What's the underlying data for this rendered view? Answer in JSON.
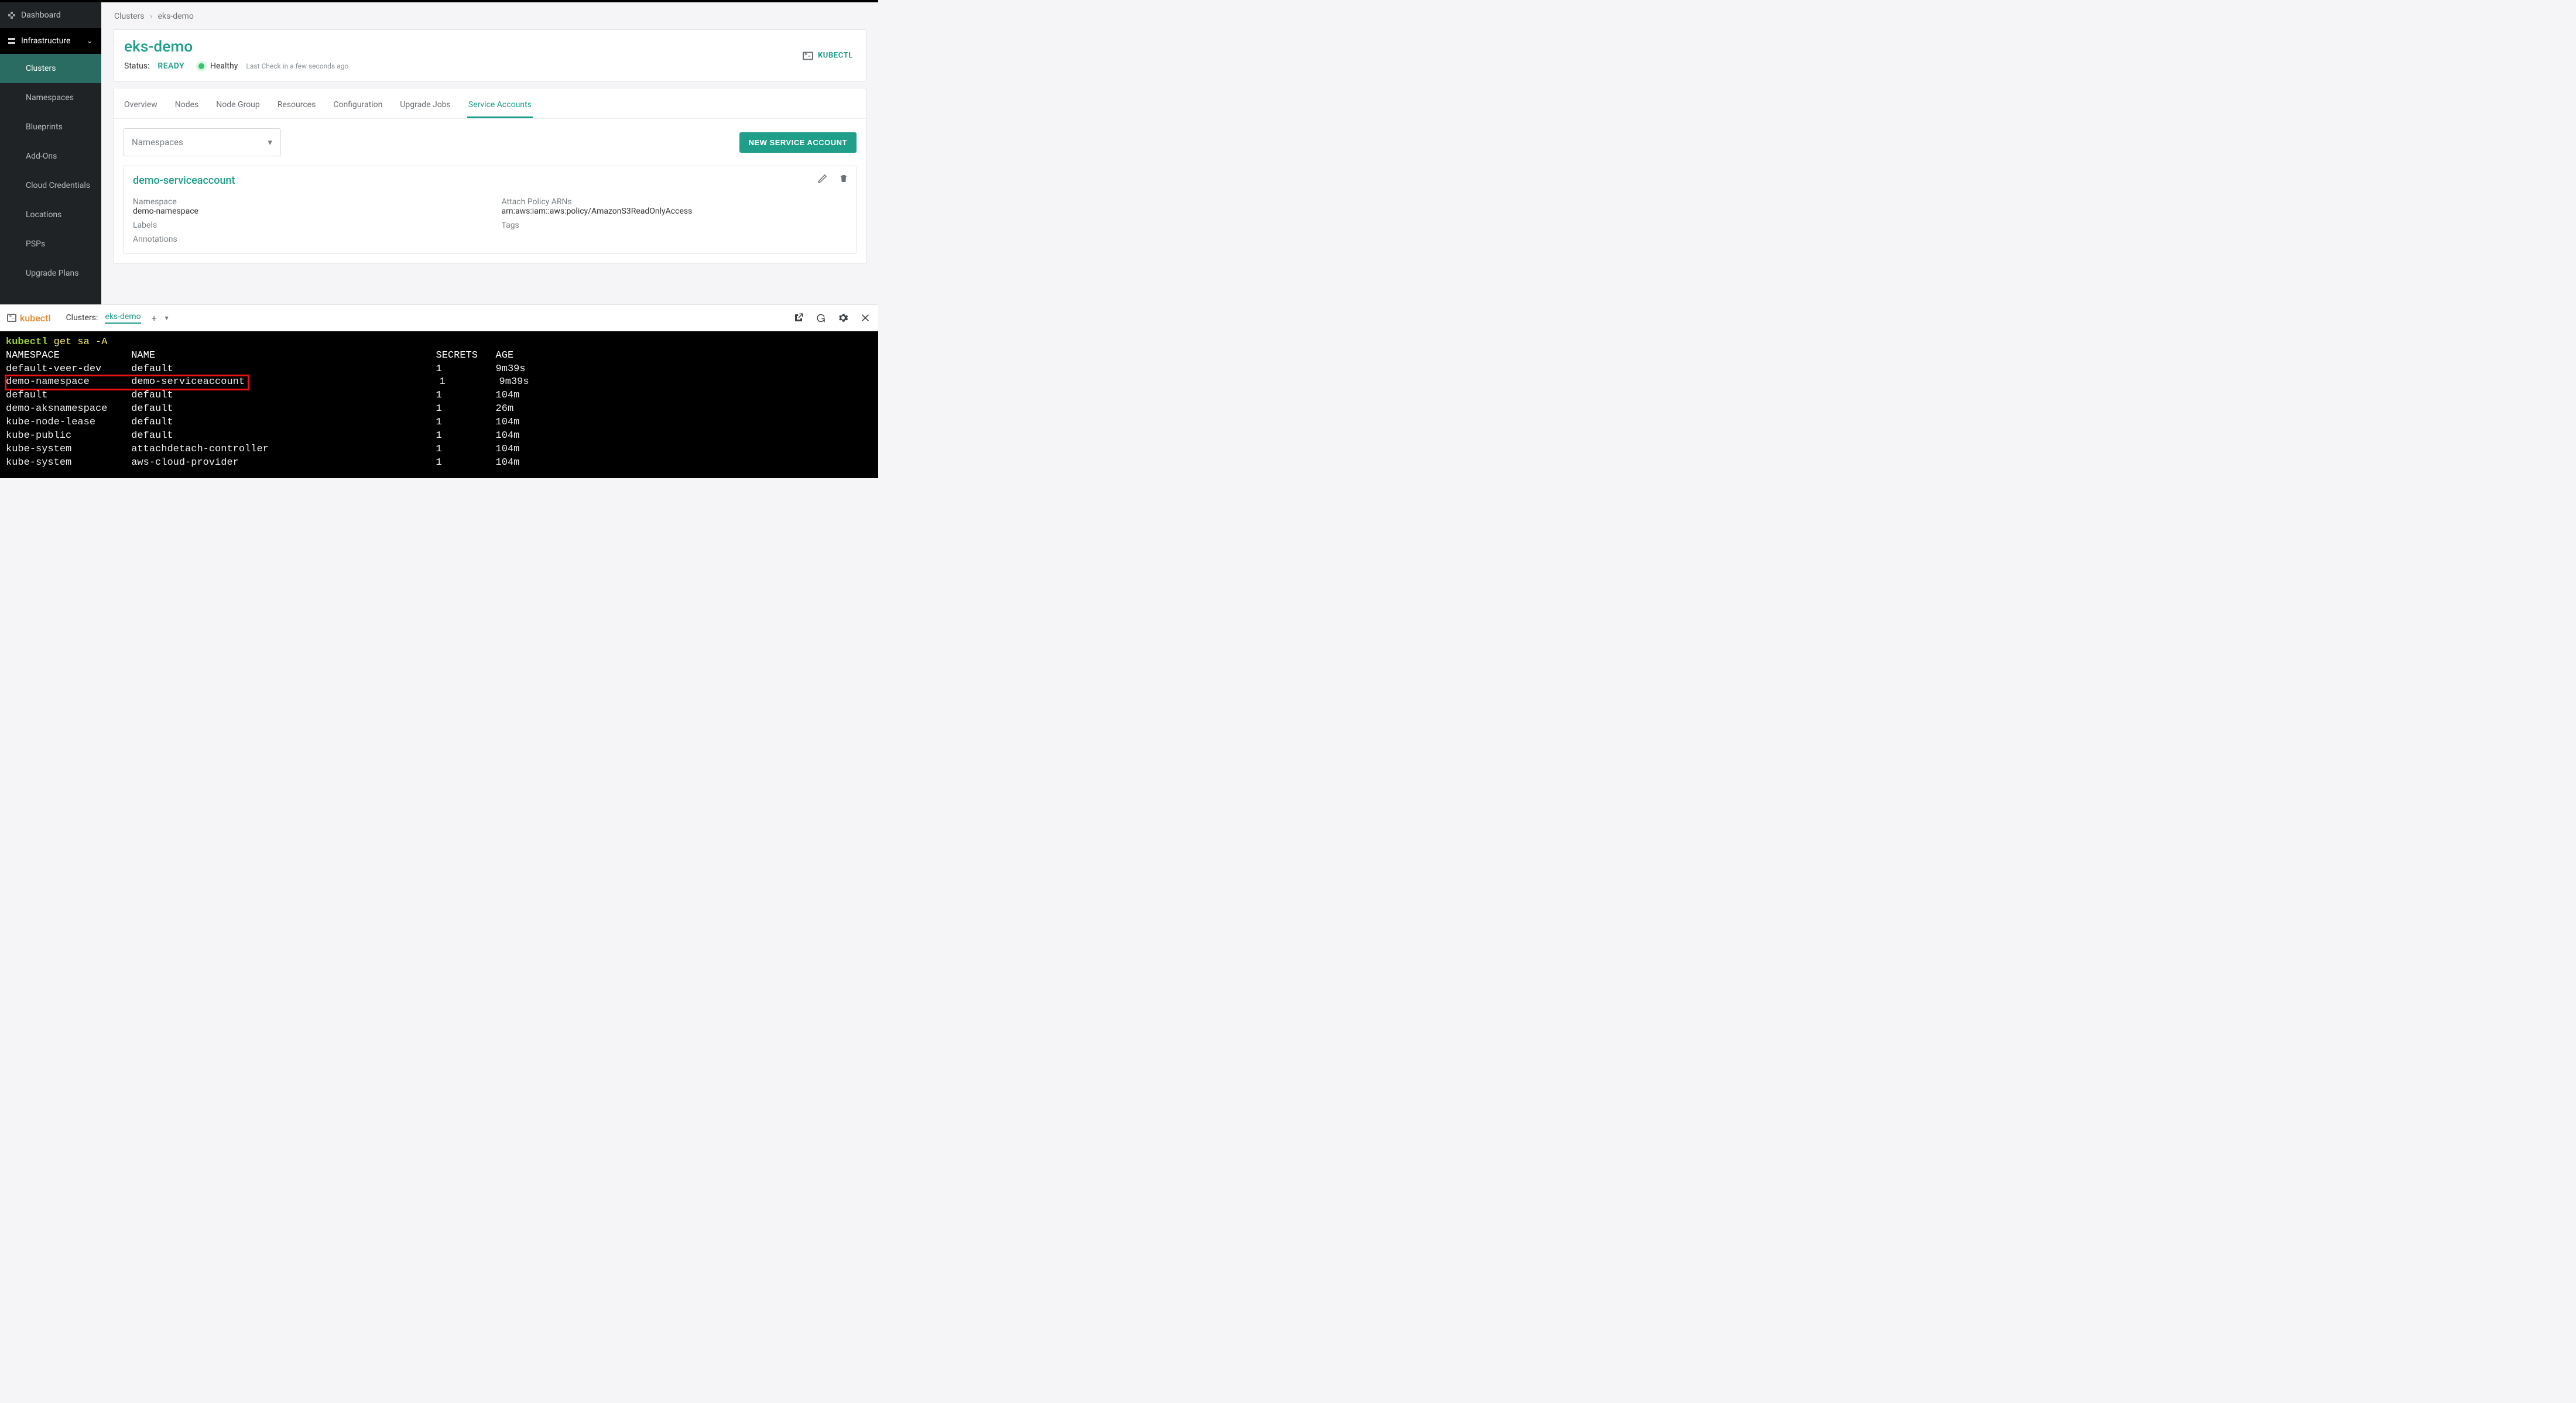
{
  "sidebar": {
    "items": [
      {
        "label": "Dashboard"
      },
      {
        "label": "Infrastructure"
      },
      {
        "label": "Clusters"
      },
      {
        "label": "Namespaces"
      },
      {
        "label": "Blueprints"
      },
      {
        "label": "Add-Ons"
      },
      {
        "label": "Cloud Credentials"
      },
      {
        "label": "Locations"
      },
      {
        "label": "PSPs"
      },
      {
        "label": "Upgrade Plans"
      }
    ]
  },
  "breadcrumb": {
    "root": "Clusters",
    "sep": "›",
    "current": "eks-demo"
  },
  "header": {
    "title": "eks-demo",
    "status_label": "Status:",
    "status_value": "READY",
    "health": "Healthy",
    "last_check": "Last Check in a few seconds ago",
    "kubectl_button": "KUBECTL"
  },
  "tabs": {
    "items": [
      {
        "label": "Overview"
      },
      {
        "label": "Nodes"
      },
      {
        "label": "Node Group"
      },
      {
        "label": "Resources"
      },
      {
        "label": "Configuration"
      },
      {
        "label": "Upgrade Jobs"
      },
      {
        "label": "Service Accounts"
      }
    ]
  },
  "filter": {
    "namespaces_placeholder": "Namespaces",
    "new_button": "NEW SERVICE ACCOUNT"
  },
  "service_account": {
    "title": "demo-serviceaccount",
    "ns_label": "Namespace",
    "ns_value": "demo-namespace",
    "arn_label": "Attach Policy ARNs",
    "arn_value": "arn:aws:iam::aws:policy/AmazonS3ReadOnlyAccess",
    "labels_label": "Labels",
    "tags_label": "Tags",
    "annotations_label": "Annotations"
  },
  "termbar": {
    "brand": "kubectl",
    "clusters_label": "Clusters:",
    "cluster": "eks-demo",
    "plus": "+"
  },
  "terminal": {
    "prompt_bin": "kubectl",
    "prompt_args": " get sa -A",
    "header": "NAMESPACE            NAME                                               SECRETS   AGE",
    "rows": [
      "default-veer-dev     default                                            1         9m39s",
      "demo-namespace       demo-serviceaccount                                1         9m39s",
      "default              default                                            1         104m",
      "demo-aksnamespace    default                                            1         26m",
      "kube-node-lease      default                                            1         104m",
      "kube-public          default                                            1         104m",
      "kube-system          attachdetach-controller                            1         104m",
      "kube-system          aws-cloud-provider                                 1         104m"
    ],
    "highlight_row_index": 1,
    "highlight_width_chars": 40
  }
}
